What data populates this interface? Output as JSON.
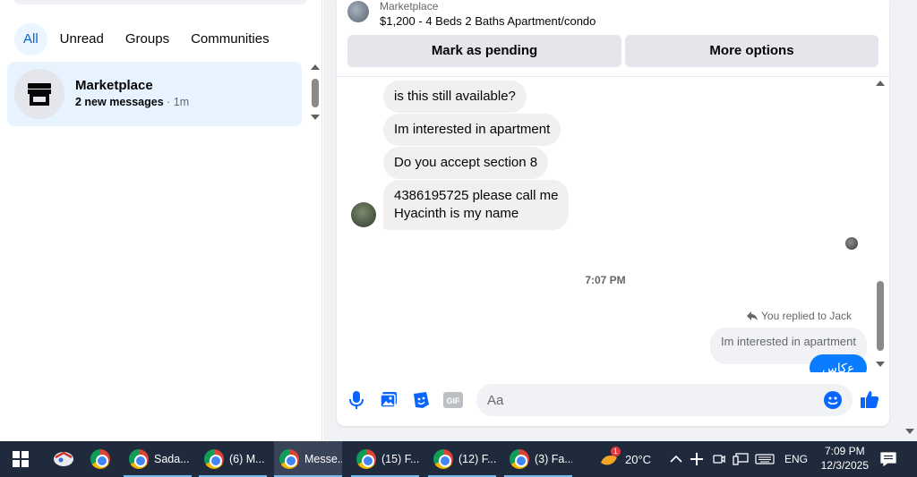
{
  "filters": {
    "all": "All",
    "unread": "Unread",
    "groups": "Groups",
    "communities": "Communities"
  },
  "conversation": {
    "title": "Marketplace",
    "new_messages": "2 new messages",
    "time": " · 1m"
  },
  "listing": {
    "source": "Marketplace",
    "title": "$1,200 - 4 Beds 2 Baths Apartment/condo",
    "mark_pending": "Mark as pending",
    "more_options": "More options"
  },
  "messages": [
    {
      "text": "is this still available?"
    },
    {
      "text": "Im interested in apartment"
    },
    {
      "text": "Do you accept section 8"
    },
    {
      "line1": "4386195725 please call me",
      "line2": "Hyacinth is my name"
    }
  ],
  "timestamp": "7:07 PM",
  "reply": {
    "label": "You replied to Jack",
    "quote": "Im interested in apartment",
    "own_text": "ع‌کاس"
  },
  "composer": {
    "placeholder": "Aa"
  },
  "taskbar": {
    "apps": [
      "Sada...",
      "(6) M...",
      "Messe...",
      "(15) F...",
      "(12) F...",
      "(3) Fa..."
    ],
    "weather": "20°C",
    "weather_badge": "1",
    "language": "ENG",
    "time": "7:09 PM",
    "date": "12/3/2025"
  },
  "colors": {
    "accent": "#0866ff",
    "bubble": "#f0f0f0",
    "taskbar": "#1f2a3c"
  }
}
